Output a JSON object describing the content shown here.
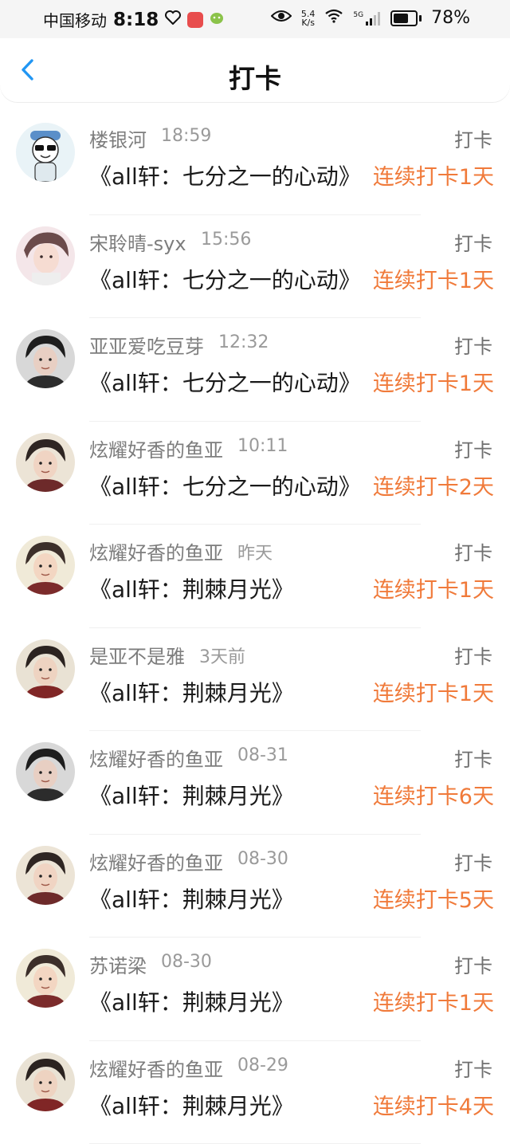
{
  "status_bar": {
    "carrier": "中国移动",
    "time": "8:18",
    "net_speed_value": "5.4",
    "net_speed_unit": "K/s",
    "network_type": "5G",
    "battery": "78%",
    "battery_level": 0.78
  },
  "header": {
    "title": "打卡",
    "accent_color": "#2196f3"
  },
  "colors": {
    "streak": "#f07a3a",
    "name": "#7d7d7d",
    "time": "#9a9a9a"
  },
  "rows": [
    {
      "name": "楼银河",
      "time": "18:59",
      "action": "打卡",
      "content": "《all轩：七分之一的心动》",
      "streak": "连续打卡1天",
      "avatar": "cartoon-avatar"
    },
    {
      "name": "宋聆晴-syx",
      "time": "15:56",
      "action": "打卡",
      "content": "《all轩：七分之一的心动》",
      "streak": "连续打卡1天",
      "avatar": "illustration-avatar"
    },
    {
      "name": "亚亚爱吃豆芽",
      "time": "12:32",
      "action": "打卡",
      "content": "《all轩：七分之一的心动》",
      "streak": "连续打卡1天",
      "avatar": "photo-avatar"
    },
    {
      "name": "炫耀好香的鱼亚",
      "time": "10:11",
      "action": "打卡",
      "content": "《all轩：七分之一的心动》",
      "streak": "连续打卡2天",
      "avatar": "photo-avatar"
    },
    {
      "name": "炫耀好香的鱼亚",
      "time": "昨天",
      "action": "打卡",
      "content": "《all轩：荆棘月光》",
      "streak": "连续打卡1天",
      "avatar": "photo-avatar"
    },
    {
      "name": "是亚不是雅",
      "time": "3天前",
      "action": "打卡",
      "content": "《all轩：荆棘月光》",
      "streak": "连续打卡1天",
      "avatar": "photo-avatar"
    },
    {
      "name": "炫耀好香的鱼亚",
      "time": "08-31",
      "action": "打卡",
      "content": "《all轩：荆棘月光》",
      "streak": "连续打卡6天",
      "avatar": "photo-avatar"
    },
    {
      "name": "炫耀好香的鱼亚",
      "time": "08-30",
      "action": "打卡",
      "content": "《all轩：荆棘月光》",
      "streak": "连续打卡5天",
      "avatar": "photo-avatar"
    },
    {
      "name": "苏诺梁",
      "time": "08-30",
      "action": "打卡",
      "content": "《all轩：荆棘月光》",
      "streak": "连续打卡1天",
      "avatar": "photo-avatar"
    },
    {
      "name": "炫耀好香的鱼亚",
      "time": "08-29",
      "action": "打卡",
      "content": "《all轩：荆棘月光》",
      "streak": "连续打卡4天",
      "avatar": "photo-avatar"
    }
  ]
}
